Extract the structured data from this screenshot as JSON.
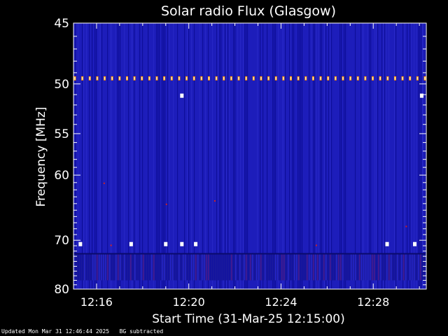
{
  "footer": {
    "updated": "Updated Mon Mar 31 12:46:44 2025",
    "note": "BG subtracted"
  },
  "chart_data": {
    "type": "heatmap",
    "title": "Solar radio Flux (Glasgow)",
    "xlabel": "Start Time (31-Mar-25 12:15:00)",
    "ylabel": "Frequency [MHz]",
    "x_ticks": [
      "12:16",
      "12:20",
      "12:24",
      "12:28"
    ],
    "x_tick_minutes": [
      1,
      5,
      9,
      13
    ],
    "xlim_minutes": [
      0,
      15.3
    ],
    "y_ticks": [
      45,
      50,
      55,
      60,
      70,
      80
    ],
    "ylim": [
      45,
      80
    ],
    "y_scale": "reciprocal",
    "colors": {
      "background": "#1a1ab4",
      "low": "#0a0a8c",
      "high": "#ff8c00",
      "peak": "#ffffff",
      "axis": "#ffffff"
    },
    "features": {
      "interference_line_freq_mhz": 49.5,
      "interference_line_count": 48,
      "lower_band_mhz": [
        72.5,
        78
      ],
      "bright_points": [
        {
          "minute": 0.3,
          "freq": 70.7
        },
        {
          "minute": 2.5,
          "freq": 70.7
        },
        {
          "minute": 4.0,
          "freq": 70.7
        },
        {
          "minute": 4.7,
          "freq": 70.7
        },
        {
          "minute": 5.3,
          "freq": 70.7
        },
        {
          "minute": 4.7,
          "freq": 51.1
        },
        {
          "minute": 13.6,
          "freq": 70.7
        },
        {
          "minute": 14.8,
          "freq": 70.7
        },
        {
          "minute": 15.1,
          "freq": 51.1
        }
      ]
    }
  }
}
